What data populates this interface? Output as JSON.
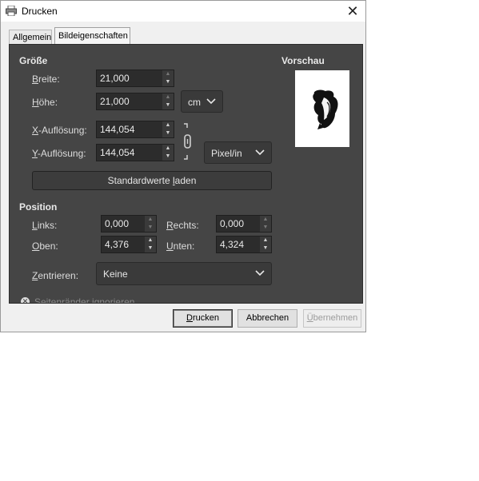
{
  "window": {
    "title": "Drucken",
    "close_glyph": "✕"
  },
  "tabs": [
    {
      "label": "Allgemein",
      "active": false
    },
    {
      "label": "Bildeigenschaften",
      "active": true
    }
  ],
  "groesse": {
    "heading": "Größe",
    "breite": {
      "label_first": "B",
      "label_rest": "reite:",
      "value": "21,000"
    },
    "hoehe": {
      "label_first": "H",
      "label_rest": "öhe:",
      "value": "21,000"
    },
    "unit": "cm",
    "x_aufloesung": {
      "label_first": "X",
      "label_rest": "-Auflösung:",
      "value": "144,054"
    },
    "y_aufloesung": {
      "label_first": "Y",
      "label_rest": "-Auflösung:",
      "value": "144,054"
    },
    "resolution_unit": "Pixel/in",
    "reset_button": {
      "before": "Standardwerte ",
      "ul": "l",
      "after": "aden"
    }
  },
  "vorschau": {
    "heading": "Vorschau"
  },
  "position": {
    "heading": "Position",
    "links": {
      "label_first": "L",
      "label_rest": "inks:",
      "value": "0,000"
    },
    "rechts": {
      "label_first": "R",
      "label_rest": "echts:",
      "value": "0,000"
    },
    "oben": {
      "label_first": "O",
      "label_rest": "ben:",
      "value": "4,376"
    },
    "unten": {
      "label_first": "U",
      "label_rest": "nten:",
      "value": "4,324"
    },
    "zentrieren": {
      "label_first": "Z",
      "label_rest": "entrieren:",
      "value": "Keine"
    },
    "ignore_margins": "Seitenränder ignorieren"
  },
  "footer": {
    "drucken": {
      "ul": "D",
      "rest": "rucken"
    },
    "abbrechen": "Abbrechen",
    "uebernehmen": {
      "ul": "Ü",
      "rest": "bernehmen"
    }
  },
  "icons": {
    "app": "printer-icon",
    "chain": "chain-link-icon",
    "preview": "preview-image"
  }
}
